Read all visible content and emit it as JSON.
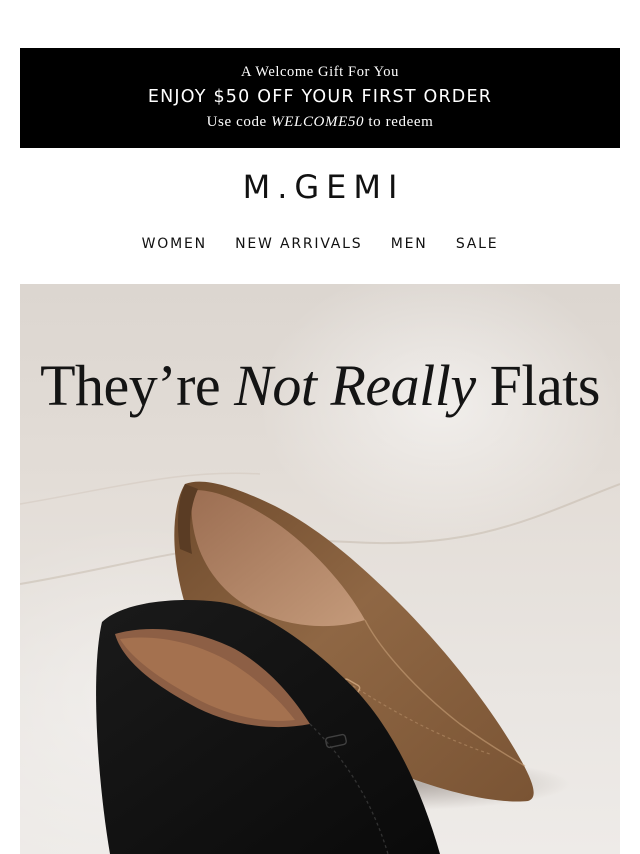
{
  "promo": {
    "eyebrow": "A Welcome Gift For You",
    "headline": "ENJOY $50 OFF YOUR FIRST ORDER",
    "code_prefix": "Use code ",
    "code": "WELCOME50",
    "code_suffix": " to redeem"
  },
  "brand": {
    "logo_text": "M.GEMI"
  },
  "nav": {
    "items": [
      {
        "label": "WOMEN"
      },
      {
        "label": "NEW ARRIVALS"
      },
      {
        "label": "MEN"
      },
      {
        "label": "SALE"
      }
    ]
  },
  "hero": {
    "title_part1": "They’re ",
    "title_italic": "Not Really",
    "title_part2": " Flats",
    "image": "brown-and-black-suede-loafers",
    "colors": {
      "brown_suede": "#8a6240",
      "black_suede": "#111111",
      "lining": "#b8896a"
    }
  }
}
